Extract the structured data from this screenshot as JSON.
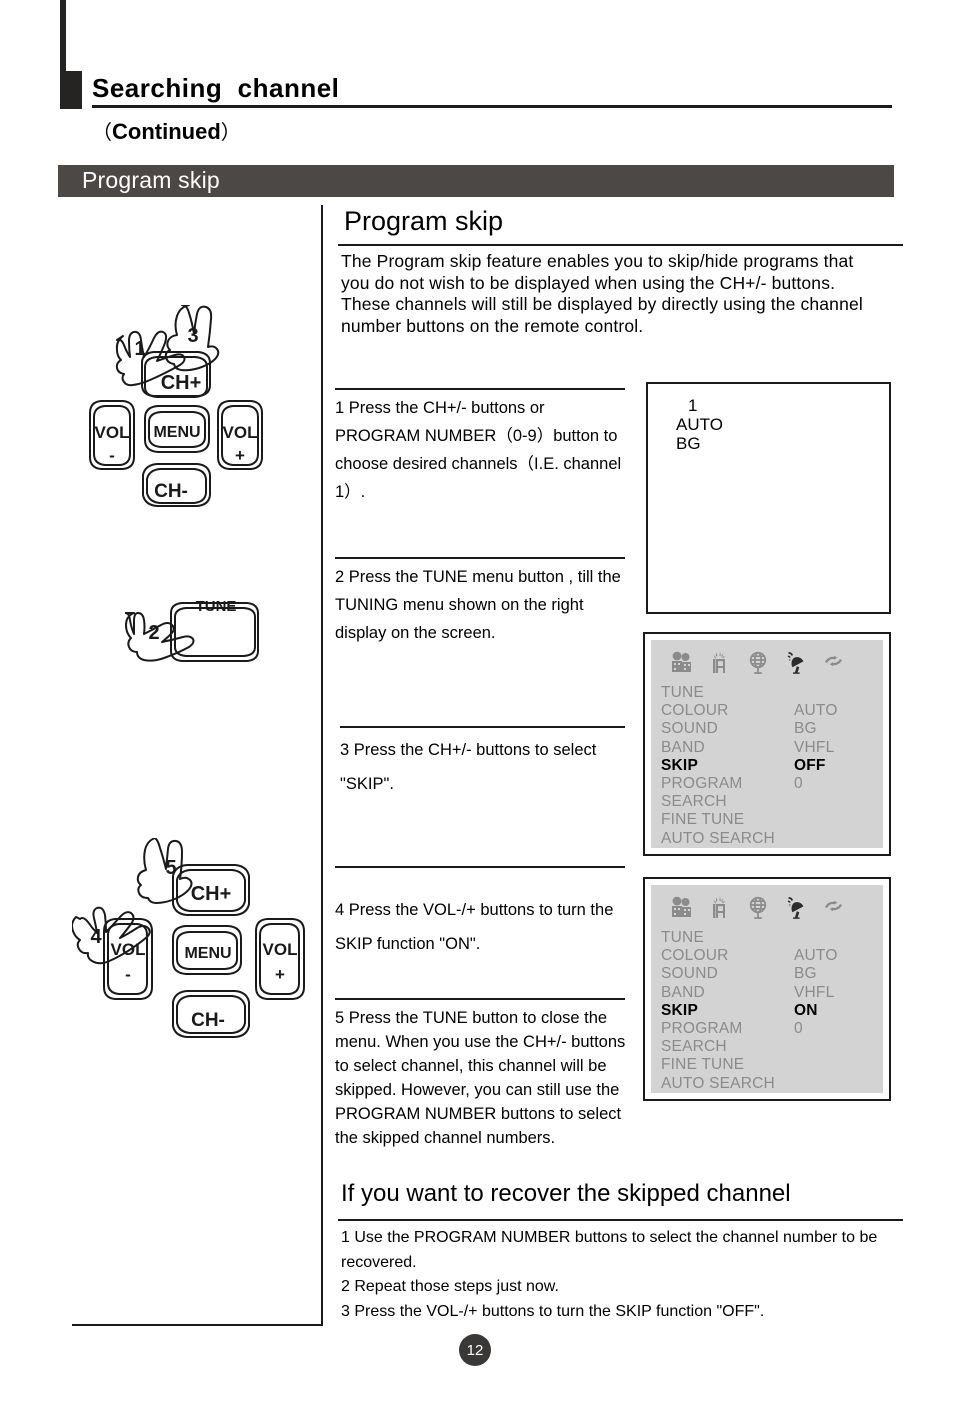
{
  "header": {
    "title": "Searching  channel",
    "subtitle_open": "（",
    "subtitle": "Continued",
    "subtitle_close": "）",
    "section_bar": "Program skip"
  },
  "main": {
    "heading": "Program skip",
    "intro": "The Program skip feature enables you to skip/hide programs that you do not wish to be displayed when using the CH+/- buttons. These channels will still be displayed by directly using the channel number buttons on the remote control."
  },
  "steps": [
    {
      "n": "1",
      "text": "1 Press the CH+/-  buttons or PROGRAM NUMBER（0-9）button to choose desired channels（I.E.  channel 1）."
    },
    {
      "n": "2",
      "text": "2 Press  the TUNE menu button , till the TUNING menu shown on  the right display on the screen."
    },
    {
      "n": "3",
      "text": "3 Press the CH+/- buttons  to select \"SKIP\"."
    },
    {
      "n": "4",
      "text": "4 Press the VOL-/+ buttons  to turn  the SKIP function  \"ON\"."
    },
    {
      "n": "5",
      "text": "5 Press the TUNE  button to close the menu. When you use the CH+/- buttons to select channel, this channel will be skipped. However, you can still use the PROGRAM NUMBER buttons to select the  skipped channel numbers."
    }
  ],
  "tv_screen": {
    "channel": "1",
    "colour_system": "AUTO",
    "sound_system": "BG"
  },
  "osd_menus": [
    {
      "id": "tuning-menu-skip-off",
      "icons": [
        "picture-icon",
        "sound-icon",
        "globe-icon",
        "satellite-dish-icon",
        "refresh-icon"
      ],
      "rows": [
        {
          "label": "TUNE",
          "value": "",
          "active": false
        },
        {
          "label": "COLOUR",
          "value": "AUTO",
          "active": false
        },
        {
          "label": "SOUND",
          "value": "BG",
          "active": false
        },
        {
          "label": "BAND",
          "value": "VHFL",
          "active": false
        },
        {
          "label": "SKIP",
          "value": "OFF",
          "active": true
        },
        {
          "label": "PROGRAM",
          "value": "0",
          "active": false
        },
        {
          "label": "SEARCH",
          "value": "",
          "active": false
        },
        {
          "label": "FINE TUNE",
          "value": "",
          "active": false
        },
        {
          "label": "AUTO SEARCH",
          "value": "",
          "active": false
        }
      ]
    },
    {
      "id": "tuning-menu-skip-on",
      "icons": [
        "picture-icon",
        "sound-icon",
        "globe-icon",
        "satellite-dish-icon",
        "refresh-icon"
      ],
      "rows": [
        {
          "label": "TUNE",
          "value": "",
          "active": false
        },
        {
          "label": "COLOUR",
          "value": "AUTO",
          "active": false
        },
        {
          "label": "SOUND",
          "value": "BG",
          "active": false
        },
        {
          "label": "BAND",
          "value": "VHFL",
          "active": false
        },
        {
          "label": "SKIP",
          "value": "ON",
          "active": true
        },
        {
          "label": "PROGRAM",
          "value": "0",
          "active": false
        },
        {
          "label": "SEARCH",
          "value": "",
          "active": false
        },
        {
          "label": "FINE TUNE",
          "value": "",
          "active": false
        },
        {
          "label": "AUTO SEARCH",
          "value": "",
          "active": false
        }
      ]
    }
  ],
  "recover": {
    "heading": "If you want to recover the skipped channel",
    "lines": [
      "1 Use the PROGRAM NUMBER buttons  to select the channel number  to be recovered.",
      "2 Repeat those steps just now.",
      "3 Press the VOL-/+ buttons to turn the SKIP function \"OFF\"."
    ]
  },
  "remote_illustrations": {
    "top": {
      "hand_labels": [
        "1",
        "3"
      ],
      "buttons": [
        "CH+",
        "VOL\n-",
        "MENU",
        "VOL\n+",
        "CH-"
      ],
      "ch_up": "CH+",
      "vol_down_l1": "VOL",
      "vol_down_l2": "-",
      "menu": "MENU",
      "vol_up_l1": "VOL",
      "vol_up_l2": "+",
      "ch_down": "CH-"
    },
    "tune": {
      "hand_label": "2",
      "button": "TUNE"
    },
    "bottom": {
      "hand_labels": [
        "4",
        "5"
      ],
      "ch_up": "CH+",
      "vol_down_l1": "VOL",
      "vol_down_l2": "-",
      "menu": "MENU",
      "vol_up_l1": "VOL",
      "vol_up_l2": "+",
      "ch_down": "CH-"
    }
  },
  "footer": {
    "page_number": "12"
  },
  "colors": {
    "bar_gray": "#4c4846",
    "osd_bg": "#d3d3d3",
    "osd_text_inactive": "#8b8b8b",
    "ink": "#1a1a1a"
  }
}
